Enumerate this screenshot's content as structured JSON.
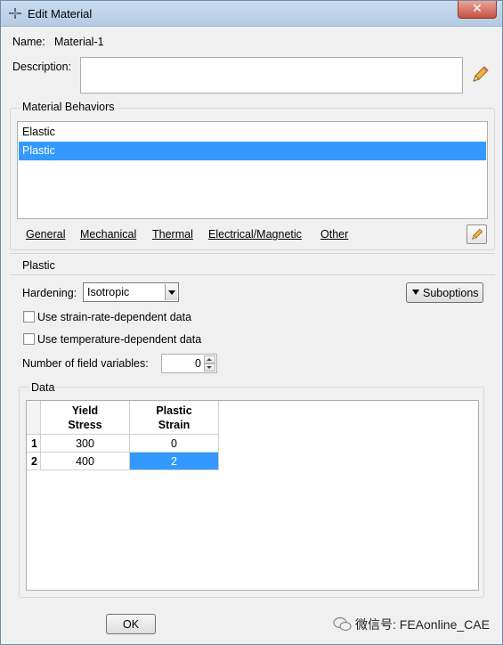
{
  "window": {
    "title": "Edit Material",
    "close_glyph": "✕"
  },
  "name": {
    "label": "Name:",
    "value": "Material-1"
  },
  "description": {
    "label": "Description:",
    "value": ""
  },
  "behaviors": {
    "title": "Material Behaviors",
    "items": [
      {
        "label": "Elastic",
        "selected": false
      },
      {
        "label": "Plastic",
        "selected": true
      }
    ]
  },
  "menus": [
    "General",
    "Mechanical",
    "Thermal",
    "Electrical/Magnetic",
    "Other"
  ],
  "plastic": {
    "section_title": "Plastic",
    "hardening_label": "Hardening:",
    "hardening_value": "Isotropic",
    "suboptions_label": "Suboptions",
    "strain_rate_label": "Use strain-rate-dependent data",
    "temperature_label": "Use temperature-dependent data",
    "field_vars_label": "Number of field variables:",
    "field_vars_value": "0"
  },
  "data_table": {
    "title": "Data",
    "col1": {
      "line1": "Yield",
      "line2": "Stress"
    },
    "col2": {
      "line1": "Plastic",
      "line2": "Strain"
    },
    "rows": [
      {
        "index": "1",
        "yield_stress": "300",
        "plastic_strain": "0"
      },
      {
        "index": "2",
        "yield_stress": "400",
        "plastic_strain": "2"
      }
    ]
  },
  "footer": {
    "ok_label": "OK"
  },
  "watermark": {
    "text": "微信号: FEAonline_CAE"
  },
  "colors": {
    "selection": "#3399ff",
    "titlebar": "#c9dcef",
    "close": "#c7513f"
  },
  "icons": [
    "app-icon",
    "close-icon",
    "pencil-icon",
    "dropdown-arrow-icon",
    "spin-up-icon",
    "spin-down-icon",
    "wechat-icon"
  ]
}
